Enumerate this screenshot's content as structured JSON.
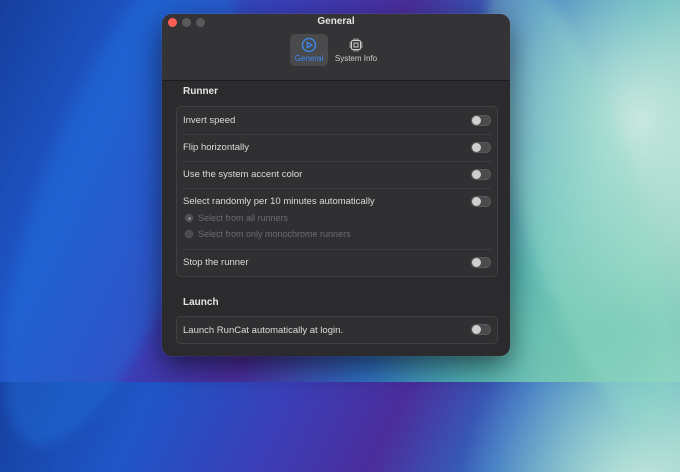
{
  "window": {
    "title": "General"
  },
  "toolbar": {
    "tabs": [
      {
        "label": "General",
        "icon": "speedometer-icon",
        "selected": true
      },
      {
        "label": "System Info",
        "icon": "cpu-chip-icon",
        "selected": false
      }
    ]
  },
  "runner": {
    "title": "Runner",
    "invert_speed": {
      "label": "Invert speed",
      "on": false
    },
    "flip_horizontally": {
      "label": "Flip horizontally",
      "on": false
    },
    "accent_color": {
      "label": "Use the system accent color",
      "on": false
    },
    "random": {
      "label": "Select randomly per 10 minutes automatically",
      "on": false
    },
    "options": [
      {
        "label": "Select from all runners",
        "selected": true,
        "enabled": false
      },
      {
        "label": "Select from only monochrome runners",
        "selected": false,
        "enabled": false
      }
    ],
    "stop": {
      "label": "Stop the runner",
      "on": false
    }
  },
  "launch": {
    "title": "Launch",
    "login": {
      "label": "Launch RunCat automatically at login.",
      "on": false
    }
  },
  "colors": {
    "accent": "#3b8cf5",
    "close": "#ff5f57",
    "window_bg": "#2b2b2d"
  }
}
